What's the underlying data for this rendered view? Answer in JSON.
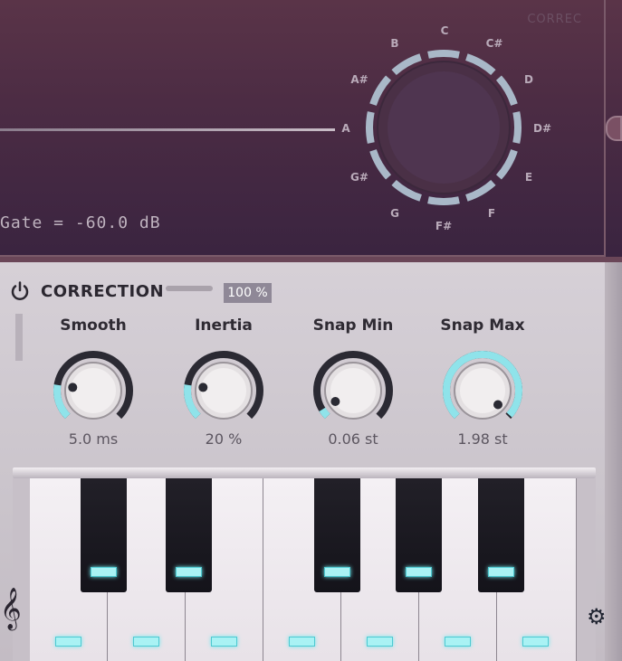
{
  "display": {
    "corner_label": "CORREC",
    "gate_text": "Gate = -60.0 dB",
    "notes": [
      "C",
      "C#",
      "D",
      "D#",
      "E",
      "F",
      "F#",
      "G",
      "G#",
      "A",
      "A#",
      "B"
    ]
  },
  "correction": {
    "title": "CORRECTION",
    "mix_value": "100 %",
    "mix": 1.0,
    "knobs": [
      {
        "label": "Smooth",
        "value": "5.0 ms",
        "level": 0.2
      },
      {
        "label": "Inertia",
        "value": "20 %",
        "level": 0.2
      },
      {
        "label": "Snap Min",
        "value": "0.06 st",
        "level": 0.05
      },
      {
        "label": "Snap Max",
        "value": "1.98 st",
        "level": 0.99
      }
    ]
  },
  "icons": {
    "power": "power-icon",
    "clef": "treble-clef-icon",
    "clef_glyph": "𝄞",
    "gear": "gear-icon",
    "gear_glyph": "⚙"
  },
  "colors": {
    "accent": "#8fe3ea",
    "led": "#a9f2f4",
    "display_bg": "#4c2c44"
  }
}
